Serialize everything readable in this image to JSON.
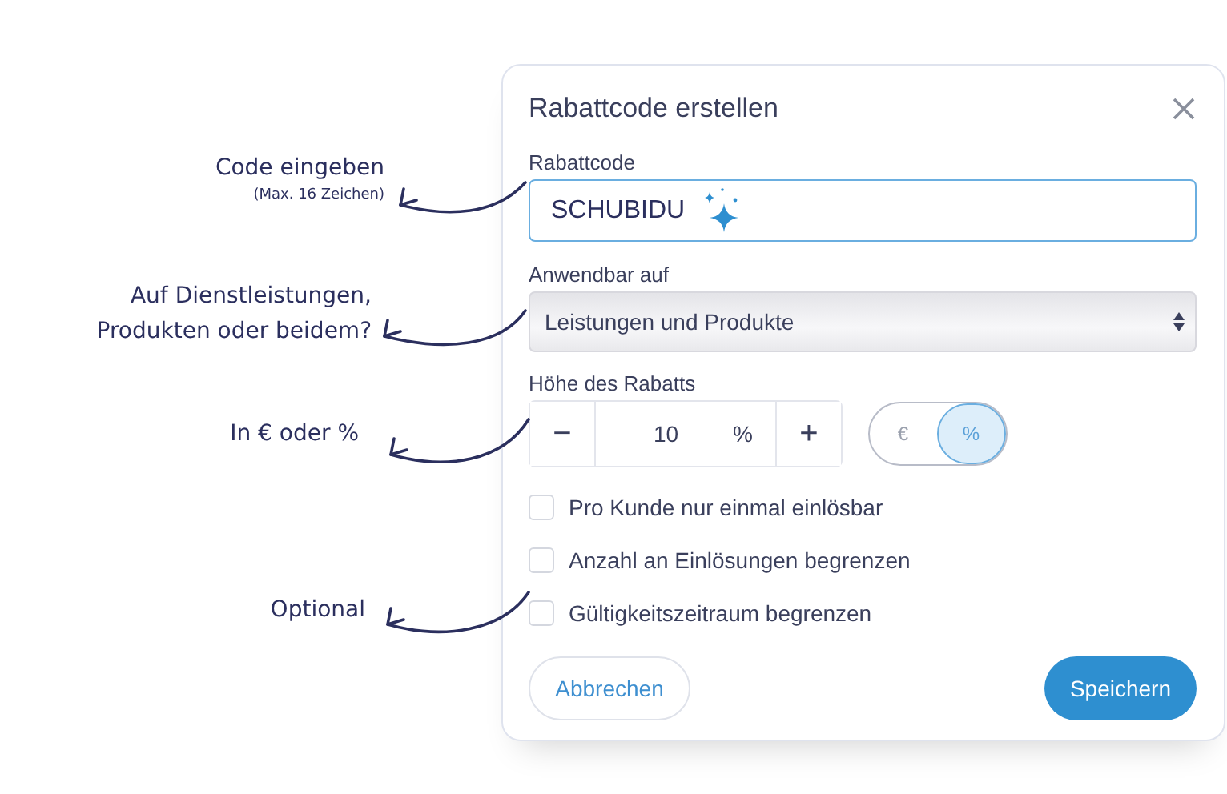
{
  "annotations": [
    {
      "lines": [
        "Code eingeben"
      ],
      "note": "(Max. 16 Zeichen)"
    },
    {
      "lines": [
        "Auf Dienstleistungen,",
        "Produkten oder beidem?"
      ]
    },
    {
      "lines": [
        "In € oder %"
      ]
    },
    {
      "lines": [
        "Optional"
      ]
    }
  ],
  "dialog": {
    "title": "Rabattcode erstellen",
    "code_field": {
      "label": "Rabattcode",
      "value": "SCHUBIDU"
    },
    "applies_to": {
      "label": "Anwendbar auf",
      "value": "Leistungen und Produkte"
    },
    "amount": {
      "label": "Höhe des Rabatts",
      "minus": "−",
      "value": "10",
      "unit": "%",
      "plus": "+",
      "toggle": [
        {
          "label": "€",
          "selected": false
        },
        {
          "label": "%",
          "selected": true
        }
      ]
    },
    "options": [
      {
        "label": "Pro Kunde nur einmal einlösbar",
        "checked": false
      },
      {
        "label": "Anzahl an Einlösungen begrenzen",
        "checked": false
      },
      {
        "label": "Gültigkeitszeitraum begrenzen",
        "checked": false
      }
    ],
    "buttons": {
      "cancel": "Abbrechen",
      "save": "Speichern"
    }
  }
}
